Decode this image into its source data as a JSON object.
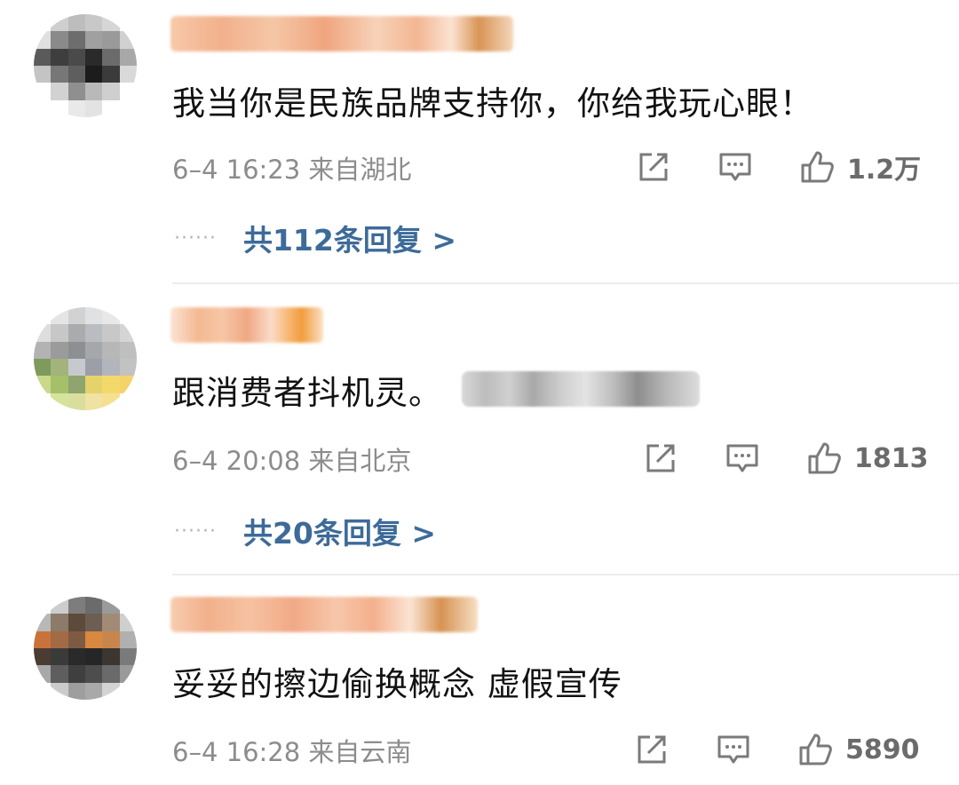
{
  "comments": [
    {
      "content": "我当你是民族品牌支持你，你给我玩心眼！",
      "meta": "6–4 16:23  来自湖北",
      "likes": "1.2万",
      "replies": "共112条回复 >",
      "avatar_colors": [
        "#ffffff",
        "#cfcfcf",
        "#bdbdbd",
        "#c8c8c8",
        "#d6d6d6",
        "#ffffff",
        "#e0e0e0",
        "#8a8a8a",
        "#6d6d6d",
        "#a0a0a0",
        "#9a9a9a",
        "#d0d0d0",
        "#5a5a5a",
        "#3e3e3e",
        "#4a4a4a",
        "#2a2a2a",
        "#6b6b6b",
        "#a8a8a8",
        "#c4c4c4",
        "#777777",
        "#5e5e5e",
        "#1c1c1c",
        "#3b3b3b",
        "#d9d9d9",
        "#ffffff",
        "#d2d2d2",
        "#8f8f8f",
        "#b9b9b9",
        "#cfcfcf",
        "#ffffff",
        "#ffffff",
        "#ffffff",
        "#e9e9e9",
        "#e3e3e3",
        "#ffffff",
        "#ffffff"
      ],
      "name_gradient": "linear-gradient(90deg,#f7c9a9 0%,#f2b08c 15%,#f5c7a6 30%,#f0a57f 45%,#f7d2b8 60%,#f3b693 72%,#fbe3d2 82%,#d99455 90%,#f4d7bb 100%)"
    },
    {
      "content": "跟消费者抖机灵。",
      "meta": "6–4 20:08  来自北京",
      "likes": "1813",
      "replies": "共20条回复 >",
      "avatar_colors": [
        "#ffffff",
        "#e5e5e5",
        "#d2d2d2",
        "#dfe1e3",
        "#e8e8e8",
        "#ffffff",
        "#dedede",
        "#c7c7c7",
        "#a9abad",
        "#b9bcc0",
        "#c8c8c8",
        "#d5d5d5",
        "#b3b3b3",
        "#9b9b9b",
        "#8d8f92",
        "#a5a7ab",
        "#b7b7b7",
        "#bfbfbf",
        "#7f9a5c",
        "#a2b47c",
        "#c7c9cf",
        "#9c9fa8",
        "#b3b5bd",
        "#c2c2c2",
        "#c9d98a",
        "#a6c06a",
        "#8fa46e",
        "#e4d36a",
        "#f3d96c",
        "#f4d36a",
        "#ffffff",
        "#d6e39b",
        "#d9de9e",
        "#efe2a2",
        "#f6e08f",
        "#ffffff"
      ],
      "name_gradient": "linear-gradient(90deg,#fbe3d4 0%,#f4b992 18%,#f7c6a6 34%,#f0a883 50%,#fbdcc9 66%,#f7b56e 78%,#f29c3c 86%,#fbe2c7 100%)"
    },
    {
      "content": "妥妥的擦边偷换概念 虚假宣传",
      "meta": "6–4 16:28  来自云南",
      "likes": "5890",
      "replies": "",
      "avatar_colors": [
        "#ffffff",
        "#cdcdcd",
        "#7d7d7d",
        "#6b6b6b",
        "#9a9a9a",
        "#ffffff",
        "#b8b8b8",
        "#8c7a6a",
        "#5e4a3a",
        "#6c5e52",
        "#a28b76",
        "#cfcfcf",
        "#c9733a",
        "#a26a45",
        "#7f5a43",
        "#d8883f",
        "#c8864c",
        "#b0b0b0",
        "#4a3b33",
        "#3a3a3a",
        "#2a2a2a",
        "#262626",
        "#3b3630",
        "#7a7a7a",
        "#a8a8a8",
        "#5e5e5e",
        "#3f3f3f",
        "#4d4d4d",
        "#6a6a6a",
        "#9a9a9a",
        "#ffffff",
        "#cbcbcb",
        "#9e9e9e",
        "#a9a9a9",
        "#d4d4d4",
        "#ffffff"
      ],
      "name_gradient": "linear-gradient(90deg,#f7cdb0 0%,#f2b08c 12%,#f6c2a1 26%,#f1a986 40%,#f7c7aa 54%,#f3b08d 66%,#fbe4d3 78%,#d69352 88%,#f7dfc5 100%)"
    }
  ]
}
